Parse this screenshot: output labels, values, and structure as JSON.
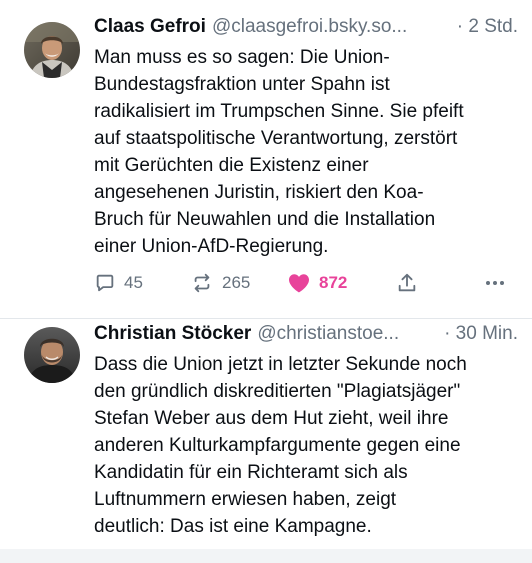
{
  "posts": [
    {
      "author_name": "Claas Gefroi",
      "handle": "@claasgefroi.bsky.so...",
      "timestamp": "· 2 Std.",
      "avatar_icon": "person-photo-icon",
      "text_lines": [
        "Man muss es so sagen: Die Union-",
        "Bundestagsfraktion unter Spahn ist",
        "radikalisiert im Trumpschen Sinne. Sie pfeift",
        "auf staatspolitische Verantwortung, zerstört",
        "mit Gerüchten die Existenz einer",
        "angesehenen Juristin, riskiert den Koa-",
        "Bruch für Neuwahlen und die Installation",
        "einer Union-AfD-Regierung."
      ],
      "actions": {
        "reply_count": "45",
        "repost_count": "265",
        "like_count": "872",
        "like_color": "#e8439a"
      }
    },
    {
      "author_name": "Christian Stöcker",
      "handle": "@christianstoe...",
      "timestamp": "· 30 Min.",
      "avatar_icon": "person-photo-icon",
      "text_lines": [
        "Dass die Union jetzt in letzter Sekunde noch",
        "den gründlich diskreditierten \"Plagiatsjäger\"",
        "Stefan Weber aus dem Hut zieht, weil ihre",
        "anderen Kulturkampfargumente gegen eine",
        "Kandidatin für ein Richteramt sich als",
        "Luftnummern erwiesen haben, zeigt",
        "deutlich: Das ist eine Kampagne."
      ]
    }
  ],
  "colors": {
    "text": "#0b0f14",
    "muted": "#66717d",
    "divider": "#e3e7eb"
  }
}
